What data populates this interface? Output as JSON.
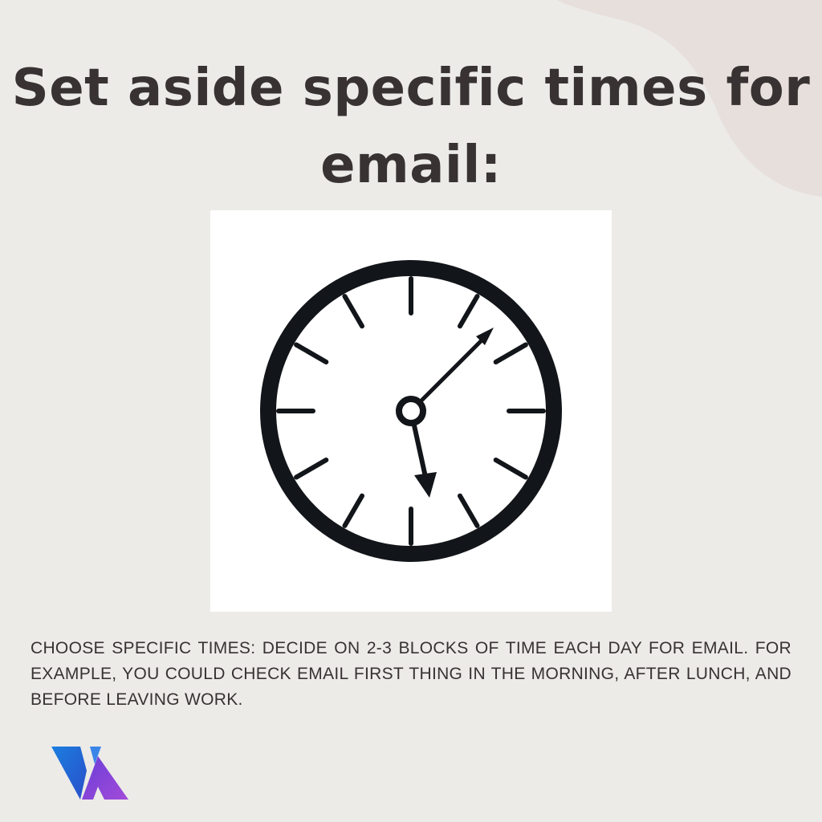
{
  "slide": {
    "title": "Set aside specific times for email:",
    "body": "CHOOSE SPECIFIC TIMES: DECIDE ON 2-3 BLOCKS OF TIME EACH DAY FOR EMAIL. FOR EXAMPLE, YOU COULD CHECK EMAIL FIRST THING IN THE MORNING, AFTER LUNCH, AND BEFORE LEAVING WORK."
  },
  "illustration": {
    "icon": "clock-icon"
  },
  "brand": {
    "logo": "va-logo"
  },
  "colors": {
    "background": "#ecebe8",
    "blob": "#e6dfdc",
    "text": "#383232",
    "clock": "#121519",
    "card": "#ffffff"
  }
}
